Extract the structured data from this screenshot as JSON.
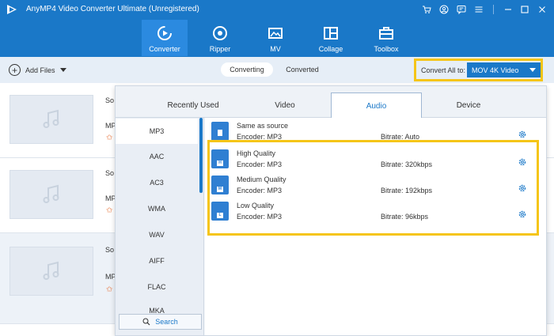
{
  "app": {
    "title": "AnyMP4 Video Converter Ultimate (Unregistered)"
  },
  "nav": {
    "tabs": [
      {
        "label": "Converter",
        "icon": "converter-icon",
        "active": true
      },
      {
        "label": "Ripper",
        "icon": "ripper-icon"
      },
      {
        "label": "MV",
        "icon": "mv-icon"
      },
      {
        "label": "Collage",
        "icon": "collage-icon"
      },
      {
        "label": "Toolbox",
        "icon": "toolbox-icon"
      }
    ]
  },
  "toolbar": {
    "add_files": "Add Files",
    "tabs": {
      "converting": "Converting",
      "converted": "Converted"
    },
    "convert_all_label": "Convert All to:",
    "convert_all_value": "MOV 4K Video"
  },
  "files": [
    {
      "name": "So",
      "meta": "MP"
    },
    {
      "name": "So",
      "meta": "MP"
    },
    {
      "name": "So",
      "meta": "MP"
    }
  ],
  "format_panel": {
    "tabs": [
      "Recently Used",
      "Video",
      "Audio",
      "Device"
    ],
    "active_tab": "Audio",
    "formats": [
      "MP3",
      "AAC",
      "AC3",
      "WMA",
      "WAV",
      "AIFF",
      "FLAC",
      "MKA"
    ],
    "selected_format": "MP3",
    "search_label": "Search",
    "presets": [
      {
        "name": "Same as source",
        "encoder": "Encoder: MP3",
        "bitrate": "Bitrate: Auto",
        "badge": ""
      },
      {
        "name": "High Quality",
        "encoder": "Encoder: MP3",
        "bitrate": "Bitrate: 320kbps",
        "badge": "H"
      },
      {
        "name": "Medium Quality",
        "encoder": "Encoder: MP3",
        "bitrate": "Bitrate: 192kbps",
        "badge": "M"
      },
      {
        "name": "Low Quality",
        "encoder": "Encoder: MP3",
        "bitrate": "Bitrate: 96kbps",
        "badge": "L"
      }
    ]
  },
  "colors": {
    "brand": "#1a78c8",
    "highlight": "#f5c518"
  }
}
